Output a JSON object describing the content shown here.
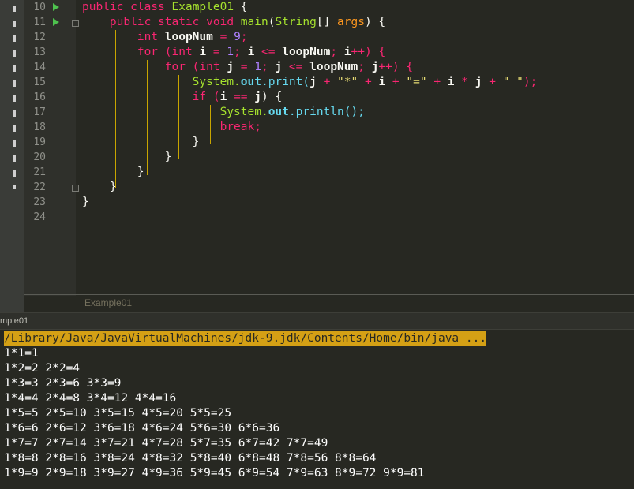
{
  "editor": {
    "line_numbers": [
      "10",
      "11",
      "12",
      "13",
      "14",
      "15",
      "16",
      "17",
      "18",
      "19",
      "20",
      "21",
      "22",
      "23",
      "24"
    ],
    "tab_label": "Example01",
    "code": {
      "l10": {
        "a": "public class ",
        "b": "Example01",
        "c": " {"
      },
      "l11": {
        "a": "    public static ",
        "b": "void ",
        "c": "main",
        "d": "(",
        "e": "String",
        "f": "[] ",
        "g": "args",
        "h": ") {"
      },
      "l12": {
        "a": "        ",
        "b": "int ",
        "c": "loopNum",
        "d": " = ",
        "e": "9",
        "f": ";"
      },
      "l13": {
        "a": "        for (",
        "b": "int ",
        "c": "i",
        "d": " = ",
        "e": "1",
        "f": "; ",
        "g": "i",
        "h": " <= ",
        "i": "loopNum",
        "j": "; ",
        "k": "i",
        "l": "++) {"
      },
      "l14": {
        "a": "            for (",
        "b": "int ",
        "c": "j",
        "d": " = ",
        "e": "1",
        "f": "; ",
        "g": "j",
        "h": " <= ",
        "i": "loopNum",
        "j": "; ",
        "k": "j",
        "l": "++) {"
      },
      "l15": {
        "a": "                System.",
        "b": "out",
        "c": ".print(",
        "d": "j",
        "e": " + ",
        "f": "\"*\"",
        "g": " + ",
        "h": "i",
        "i": " + ",
        "j": "\"=\"",
        "k": " + ",
        "l": "i",
        "m": " * ",
        "n": "j",
        "o": " + ",
        "p": "\" \"",
        "q": ");"
      },
      "l16": {
        "a": "                if (",
        "b": "i",
        "c": " == ",
        "d": "j",
        "e": ") {"
      },
      "l17": {
        "a": "                    System.",
        "b": "out",
        "c": ".println();"
      },
      "l18": {
        "a": "                    break;"
      },
      "l19": {
        "a": "                }"
      },
      "l20": {
        "a": "            }"
      },
      "l21": {
        "a": "        }"
      },
      "l22": {
        "a": "    }"
      },
      "l23": {
        "a": "}"
      },
      "l24": {
        "a": ""
      }
    }
  },
  "run_panel": {
    "title": "mple01",
    "command": "/Library/Java/JavaVirtualMachines/jdk-9.jdk/Contents/Home/bin/java ...",
    "output": [
      "1*1=1",
      "1*2=2 2*2=4",
      "1*3=3 2*3=6 3*3=9",
      "1*4=4 2*4=8 3*4=12 4*4=16",
      "1*5=5 2*5=10 3*5=15 4*5=20 5*5=25",
      "1*6=6 2*6=12 3*6=18 4*6=24 5*6=30 6*6=36",
      "1*7=7 2*7=14 3*7=21 4*7=28 5*7=35 6*7=42 7*7=49",
      "1*8=8 2*8=16 3*8=24 4*8=32 5*8=40 6*8=48 7*8=56 8*8=64",
      "1*9=9 2*9=18 3*9=27 4*9=36 5*9=45 6*9=54 7*9=63 8*9=72 9*9=81"
    ]
  },
  "colors": {
    "keyword": "#f92672",
    "class_name": "#a6e22e",
    "number": "#ae81ff",
    "string": "#e6db74",
    "command_highlight": "#d4a015",
    "background": "#272822"
  },
  "icons": {
    "run_arrow": "run-arrow-icon",
    "fold": "fold-icon"
  }
}
